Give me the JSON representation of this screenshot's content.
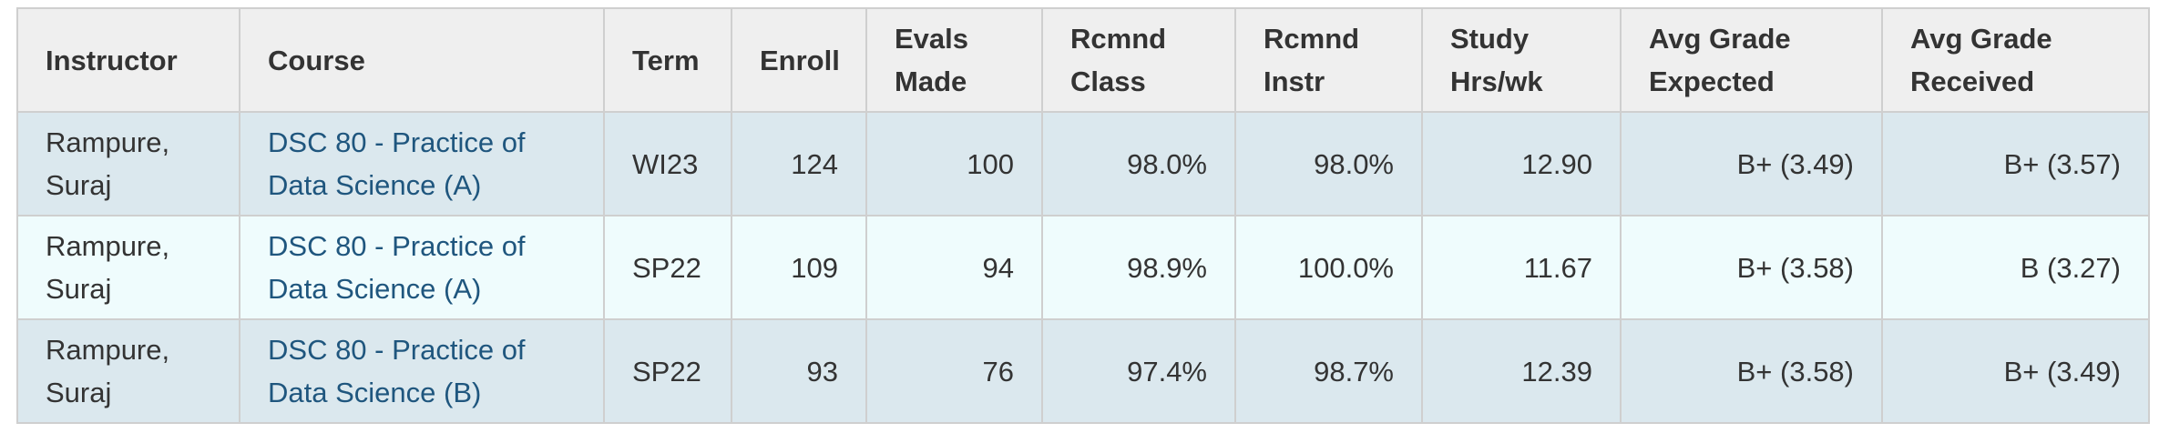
{
  "headers": {
    "instructor": "Instructor",
    "course": "Course",
    "term": "Term",
    "enroll": "Enroll",
    "evals_line1": "Evals",
    "evals_line2": "Made",
    "rcmnd_class_line1": "Rcmnd",
    "rcmnd_class_line2": "Class",
    "rcmnd_instr_line1": "Rcmnd",
    "rcmnd_instr_line2": "Instr",
    "study_line1": "Study",
    "study_line2": "Hrs/wk",
    "expected_line1": "Avg Grade",
    "expected_line2": "Expected",
    "received_line1": "Avg Grade",
    "received_line2": "Received"
  },
  "rows": [
    {
      "instructor_line1": "Rampure,",
      "instructor_line2": "Suraj",
      "course_line1": "DSC 80 - Practice of",
      "course_line2": "Data Science (A)",
      "term": "WI23",
      "enroll": "124",
      "evals_made": "100",
      "rcmnd_class": "98.0%",
      "rcmnd_instr": "98.0%",
      "study_hrs": "12.90",
      "grade_expected": "B+ (3.49)",
      "grade_received": "B+ (3.57)"
    },
    {
      "instructor_line1": "Rampure,",
      "instructor_line2": "Suraj",
      "course_line1": "DSC 80 - Practice of",
      "course_line2": "Data Science (A)",
      "term": "SP22",
      "enroll": "109",
      "evals_made": "94",
      "rcmnd_class": "98.9%",
      "rcmnd_instr": "100.0%",
      "study_hrs": "11.67",
      "grade_expected": "B+ (3.58)",
      "grade_received": "B (3.27)"
    },
    {
      "instructor_line1": "Rampure,",
      "instructor_line2": "Suraj",
      "course_line1": "DSC 80 - Practice of",
      "course_line2": "Data Science (B)",
      "term": "SP22",
      "enroll": "93",
      "evals_made": "76",
      "rcmnd_class": "97.4%",
      "rcmnd_instr": "98.7%",
      "study_hrs": "12.39",
      "grade_expected": "B+ (3.58)",
      "grade_received": "B+ (3.49)"
    }
  ],
  "colors": {
    "header_bg": "#efefef",
    "row_odd_bg": "#dbe8ee",
    "row_even_bg": "#effcfd",
    "link": "#1f567e",
    "border": "#cfcfcf"
  }
}
